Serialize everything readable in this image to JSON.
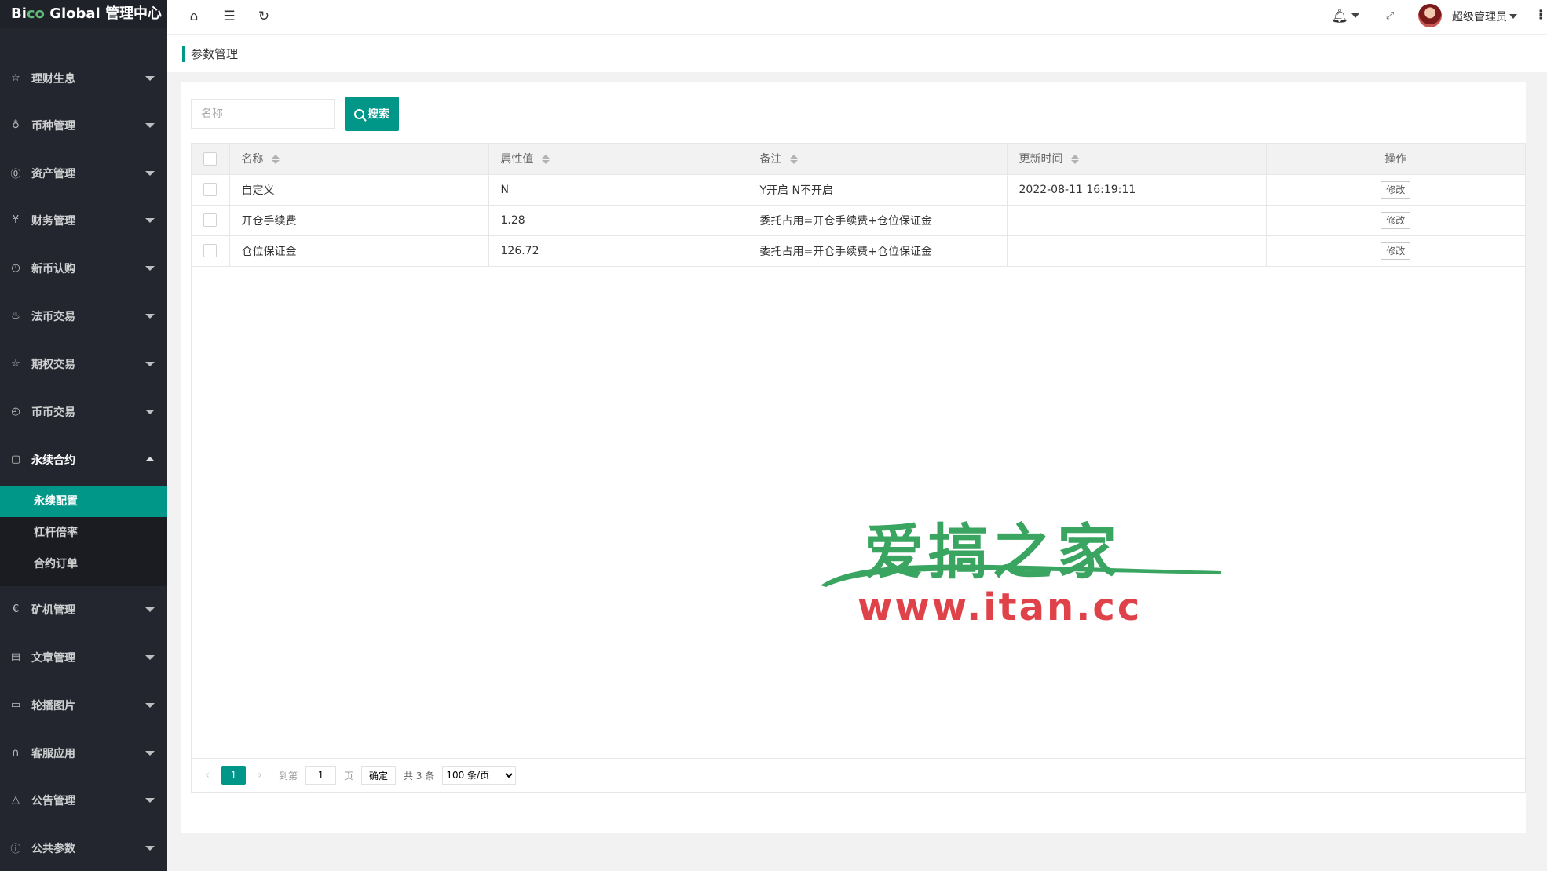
{
  "app": {
    "logo_prefix": "Bi",
    "logo_highlight": "co",
    "logo_suffix": " Global 管理中心"
  },
  "header": {
    "home_icon": "home-icon",
    "menu_icon": "menu-fold-icon",
    "refresh_icon": "refresh-icon",
    "bell_icon": "bell-icon",
    "fullscreen_icon": "fullscreen-icon",
    "user_name": "超级管理员",
    "more_icon": "more-vertical-icon"
  },
  "sidebar": {
    "items": [
      {
        "label": "理财生息",
        "icon": "star-icon",
        "glyph": "☆"
      },
      {
        "label": "币种管理",
        "icon": "coins-icon",
        "glyph": "♁"
      },
      {
        "label": "资产管理",
        "icon": "dollar-circle-icon",
        "glyph": "⓪"
      },
      {
        "label": "财务管理",
        "icon": "yen-circle-icon",
        "glyph": "¥"
      },
      {
        "label": "新币认购",
        "icon": "clock-icon",
        "glyph": "◷"
      },
      {
        "label": "法币交易",
        "icon": "fire-icon",
        "glyph": "♨"
      },
      {
        "label": "期权交易",
        "icon": "star-icon",
        "glyph": "☆"
      },
      {
        "label": "币币交易",
        "icon": "history-icon",
        "glyph": "◴"
      },
      {
        "label": "永续合约",
        "icon": "file-icon",
        "glyph": "▢"
      },
      {
        "label": "矿机管理",
        "icon": "dollar-sign-icon",
        "glyph": "€"
      },
      {
        "label": "文章管理",
        "icon": "read-icon",
        "glyph": "▤"
      },
      {
        "label": "轮播图片",
        "icon": "images-icon",
        "glyph": "▭"
      },
      {
        "label": "客服应用",
        "icon": "headset-icon",
        "glyph": "∩"
      },
      {
        "label": "公告管理",
        "icon": "notice-icon",
        "glyph": "△"
      },
      {
        "label": "公共参数",
        "icon": "info-circle-icon",
        "glyph": "ⓘ"
      }
    ],
    "submenu": [
      {
        "label": "永续配置"
      },
      {
        "label": "杠杆倍率"
      },
      {
        "label": "合约订单"
      }
    ]
  },
  "breadcrumb": {
    "title": "参数管理"
  },
  "search": {
    "placeholder": "名称",
    "button_label": "搜索"
  },
  "table": {
    "columns": [
      "名称",
      "属性值",
      "备注",
      "更新时间",
      "操作"
    ],
    "rows": [
      {
        "name": "自定义",
        "value": "N",
        "remark": "Y开启 N不开启",
        "updated": "2022-08-11 16:19:11",
        "action": "修改"
      },
      {
        "name": "开仓手续费",
        "value": "1.28",
        "remark": "委托占用=开仓手续费+仓位保证金",
        "updated": "",
        "action": "修改"
      },
      {
        "name": "仓位保证金",
        "value": "126.72",
        "remark": "委托占用=开仓手续费+仓位保证金",
        "updated": "",
        "action": "修改"
      }
    ]
  },
  "pagination": {
    "prev": "‹",
    "current": "1",
    "next": "›",
    "goto_label": "到第",
    "goto_value": "1",
    "page_unit": "页",
    "confirm_label": "确定",
    "total_label": "共 3 条",
    "page_size": "100 条/页"
  },
  "watermark": {
    "cn_text": "爱搞之家",
    "url_text": "www.itan.cc"
  },
  "colors": {
    "sidebar_bg": "#23262e",
    "accent": "#009688",
    "watermark_green": "#39a561",
    "watermark_red": "#e0424a"
  }
}
